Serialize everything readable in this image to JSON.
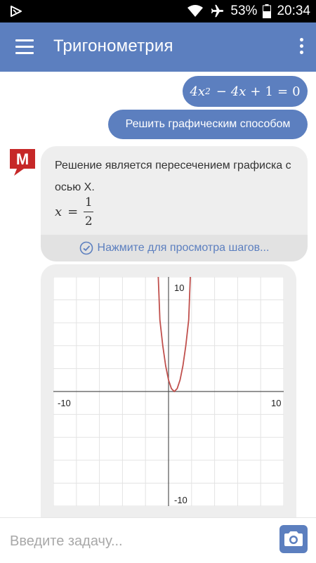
{
  "status_bar": {
    "battery": "53%",
    "time": "20:34",
    "icons": [
      "play-store-icon",
      "wifi-icon",
      "airplane-icon",
      "battery-icon"
    ]
  },
  "app_bar": {
    "title": "Тригонометрия",
    "icons": [
      "menu-icon",
      "more-vert-icon"
    ]
  },
  "chat": {
    "user_equation": "4x² − 4x + 1 = 0",
    "user_equation_parts": {
      "coef": "4x",
      "exp": "2",
      "minus": "−",
      "term": "4x",
      "plus": "+",
      "const": "1",
      "eq": "=",
      "rhs": "0"
    },
    "user_action": "Решить графическим способом",
    "bot": {
      "text": "Решение является пересечением графиска с осью X.",
      "formula": {
        "var": "x",
        "eq": "=",
        "numerator": "1",
        "denominator": "2"
      },
      "steps_link": "Нажмите для просмотра шагов...",
      "logo_letter": "M"
    }
  },
  "graph": {
    "x_min_label": "-10",
    "x_max_label": "10",
    "y_max_label": "10",
    "y_min_label": "-10",
    "curve_color": "#c0504d",
    "function": "4x^2 - 4x + 1",
    "grid": true
  },
  "input": {
    "placeholder": "Введите задачу...",
    "value": ""
  },
  "colors": {
    "accent": "#5c7fbf",
    "status_bar": "#000000",
    "bubble_bg": "#eeeeee",
    "logo_red": "#c62828"
  },
  "chart_data": {
    "type": "line",
    "title": "",
    "xlabel": "",
    "ylabel": "",
    "xlim": [
      -10,
      10
    ],
    "ylim": [
      -10,
      10
    ],
    "grid": true,
    "series": [
      {
        "x": [
          -0.9,
          -0.75,
          -0.5,
          -0.25,
          0,
          0.25,
          0.5,
          0.75,
          1,
          1.25,
          1.5,
          1.75,
          1.9
        ],
        "values": [
          10.24,
          6.25,
          4,
          2.25,
          1,
          0.25,
          0,
          0.25,
          1,
          2.25,
          4,
          6.25,
          10.24
        ]
      }
    ]
  }
}
